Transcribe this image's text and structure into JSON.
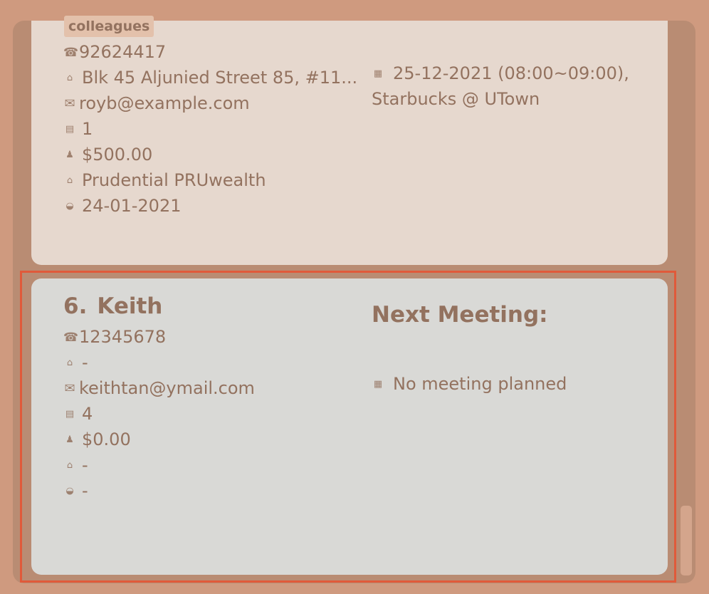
{
  "person_5": {
    "tag": "colleagues",
    "phone": "92624417",
    "address": "Blk 45 Aljunied Street 85, #11...",
    "email": "royb@example.com",
    "policies": "1",
    "premium": "$500.00",
    "plan": "Prudential PRUwealth",
    "date": "24-01-2021",
    "meeting_line1": "25-12-2021 (08:00~09:00),",
    "meeting_line2": "Starbucks @ UTown"
  },
  "person_6": {
    "index": "6.",
    "name": "Keith",
    "phone": "12345678",
    "address": "-",
    "email": "keithtan@ymail.com",
    "policies": "4",
    "premium": "$0.00",
    "plan": "-",
    "date": "-",
    "meeting_title": "Next Meeting:",
    "meeting": "No meeting planned"
  },
  "icons": {
    "phone": "phone-icon",
    "address": "home-icon",
    "email": "envelope-icon",
    "policies": "document-icon",
    "premium": "money-bag-icon",
    "plan": "building-icon",
    "date": "handshake-icon",
    "meeting": "calendar-icon"
  },
  "colors": {
    "background": "#cf9a7f",
    "panel": "#b98c73",
    "card": "#e6d8ce",
    "card_selected": "#d9d9d6",
    "text": "#93725f",
    "selection_border": "#e05a3a"
  }
}
